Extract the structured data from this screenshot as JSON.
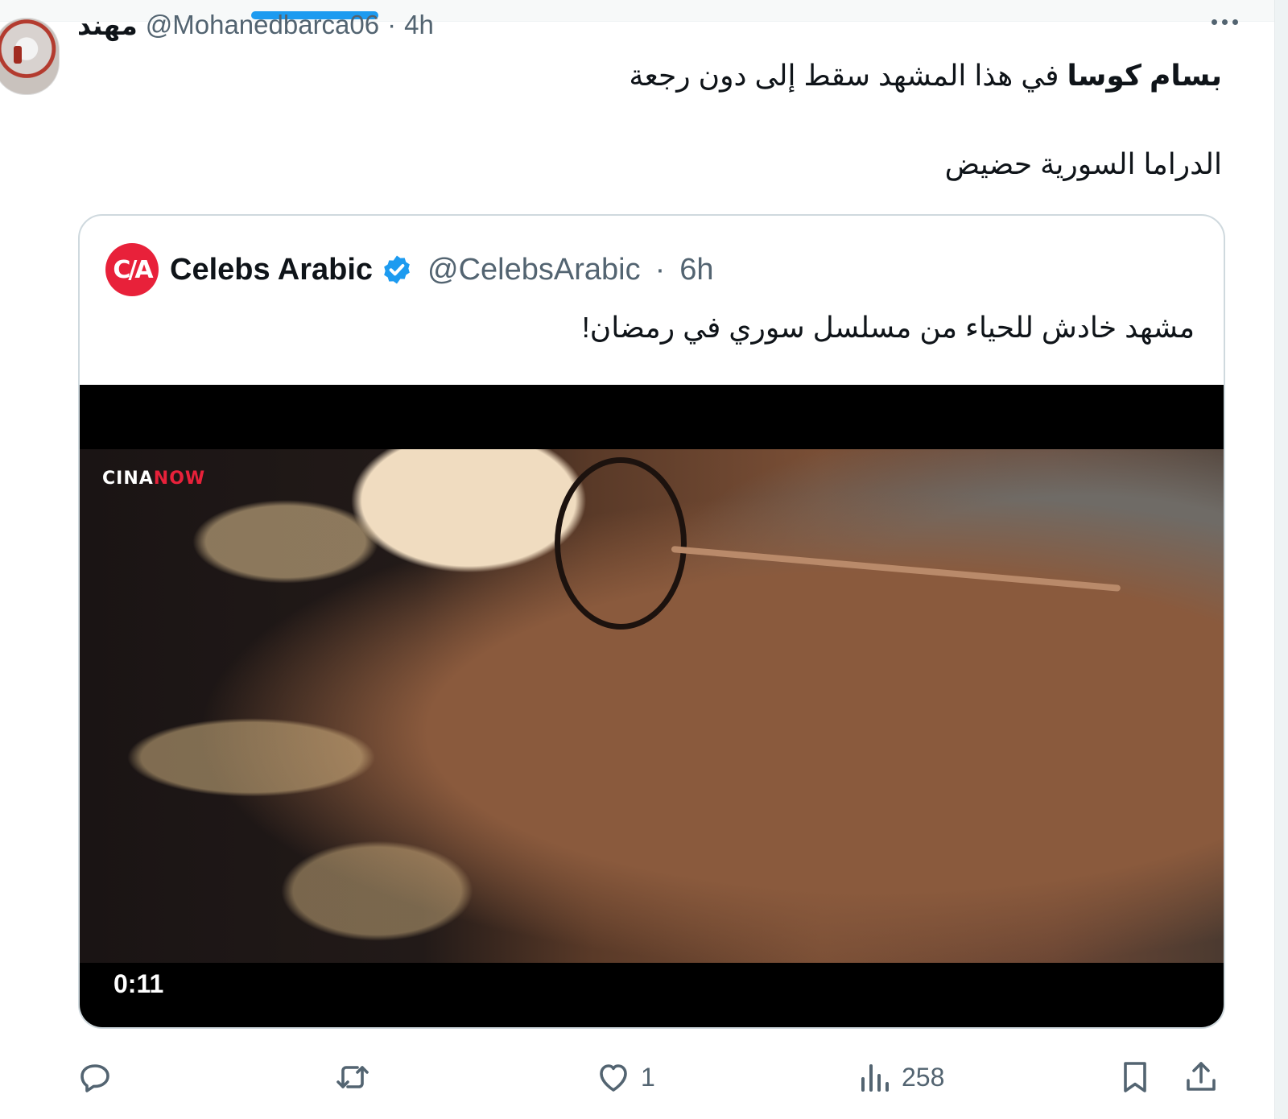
{
  "tweet": {
    "display_name": "مهند",
    "handle": "@Mohanedbarca06",
    "separator": "·",
    "time": "4h",
    "text_bold": "بسام كوسا",
    "text_rest": " في هذا المشهد سقط إلى دون رجعة",
    "text_line2": "الدراما السورية حضيض"
  },
  "quote": {
    "logo_text": "C/A",
    "name": "Celebs Arabic",
    "handle": "@CelebsArabic",
    "separator": "·",
    "time": "6h",
    "text": "مشهد خادش للحياء من مسلسل سوري في رمضان!",
    "video": {
      "watermark_a": "CINA",
      "watermark_b": "NOW",
      "duration": "0:11"
    }
  },
  "actions": {
    "reply_count": "",
    "retweet_count": "",
    "like_count": "1",
    "views_count": "258"
  },
  "colors": {
    "accent": "#1d9bf0",
    "secondary_text": "#536471",
    "logo_red": "#e8213a"
  }
}
